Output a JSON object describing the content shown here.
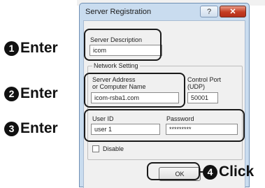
{
  "dialog": {
    "title": "Server Registration",
    "help_label": "?",
    "close_label": "✕",
    "server_description": {
      "label": "Server Description",
      "value": "icom"
    },
    "network_setting": {
      "legend": "Network Setting",
      "server_address_label_line1": "Server Address",
      "server_address_label_line2": "or Computer Name",
      "server_address_value": "icom-rsba1.com",
      "control_port_label_line1": "Control Port",
      "control_port_label_line2": "(UDP)",
      "control_port_value": "50001",
      "user_id_label": "User ID",
      "user_id_value": "user 1",
      "password_label": "Password",
      "password_value": "*********",
      "disable_label": "Disable",
      "disable_checked": false
    },
    "ok_label": "OK"
  },
  "annotations": [
    {
      "number": "1",
      "glyph": "❶",
      "text": "Enter"
    },
    {
      "number": "2",
      "glyph": "❷",
      "text": "Enter"
    },
    {
      "number": "3",
      "glyph": "❸",
      "text": "Enter"
    },
    {
      "number": "4",
      "glyph": "❹",
      "text": "Click"
    }
  ],
  "colors": {
    "title_bar": "#c9dcef",
    "close_button": "#c43c22",
    "client_area": "#f0f0f0",
    "callout": "#1a1a1a"
  }
}
